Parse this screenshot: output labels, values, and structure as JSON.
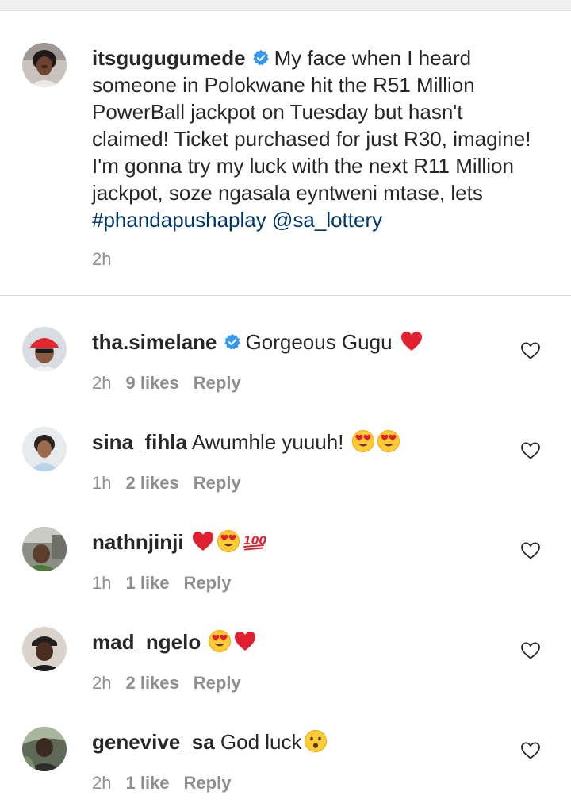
{
  "caption": {
    "username": "itsgugugumede",
    "verified": true,
    "text_pre": "My face when I heard someone in Polokwane hit the R51 Million PowerBall jackpot on Tuesday but hasn't claimed! Ticket purchased for just R30, imagine! I'm gonna try my luck with the next R11 Million jackpot, soze ngasala eyntweni mtase, lets ",
    "hashtag": "#phandapushaplay",
    "mention": "@sa_lottery",
    "time": "2h"
  },
  "comments": [
    {
      "username": "tha.simelane",
      "verified": true,
      "text": "Gorgeous Gugu",
      "emojis": [
        "red-heart"
      ],
      "time": "2h",
      "likes": "9 likes",
      "reply": "Reply"
    },
    {
      "username": "sina_fihla",
      "verified": false,
      "text": "Awumhle yuuuh!",
      "emojis": [
        "heart-eyes",
        "heart-eyes"
      ],
      "time": "1h",
      "likes": "2 likes",
      "reply": "Reply"
    },
    {
      "username": "nathnjinji",
      "verified": false,
      "text": "",
      "emojis": [
        "red-heart",
        "heart-eyes",
        "hundred-points"
      ],
      "time": "1h",
      "likes": "1 like",
      "reply": "Reply"
    },
    {
      "username": "mad_ngelo",
      "verified": false,
      "text": "",
      "emojis": [
        "heart-eyes",
        "red-heart"
      ],
      "time": "2h",
      "likes": "2 likes",
      "reply": "Reply"
    },
    {
      "username": "genevive_sa",
      "verified": false,
      "text": "God luck",
      "emojis": [
        "hushed-face"
      ],
      "time": "2h",
      "likes": "1 like",
      "reply": "Reply"
    }
  ],
  "colors": {
    "link": "#00376b",
    "verified": "#3897f0",
    "muted": "#8e8e8e",
    "heart": "#e0202e",
    "divider": "#dbdbdb"
  }
}
